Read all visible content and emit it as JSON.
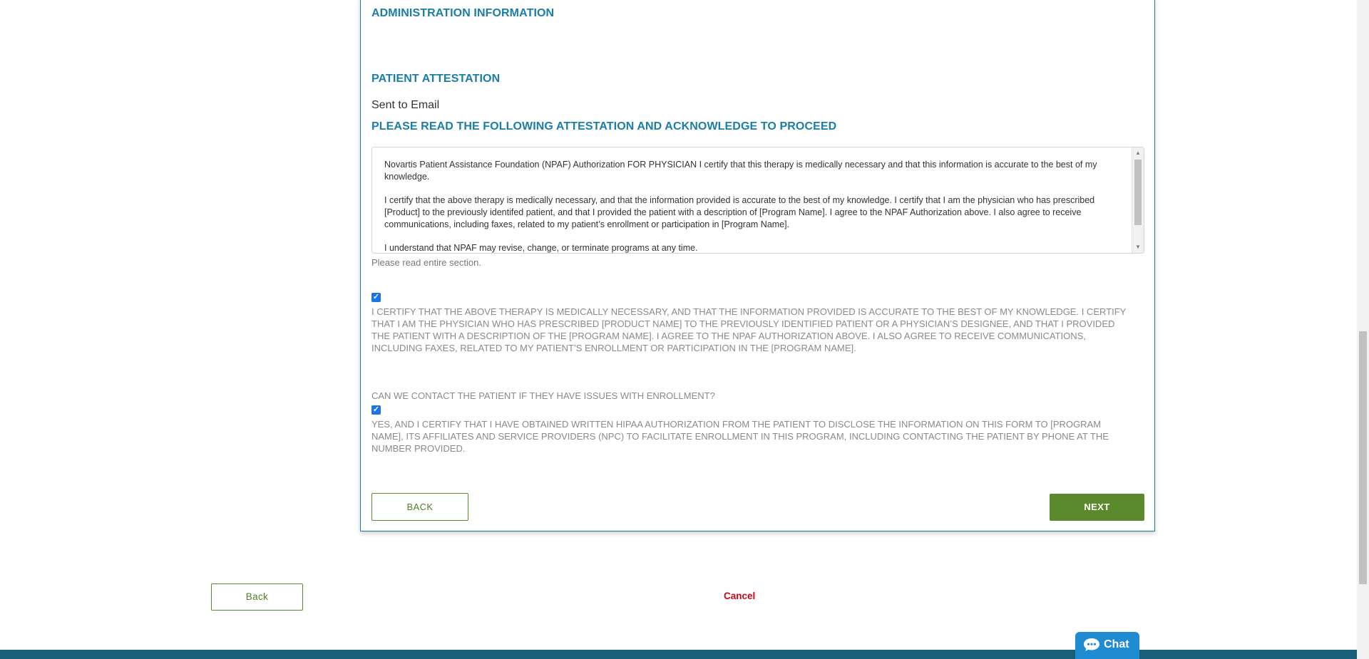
{
  "headings": {
    "admin": "ADMINISTRATION INFORMATION",
    "patient_attestation": "PATIENT ATTESTATION",
    "read_attestation": "PLEASE READ THE FOLLOWING ATTESTATION AND ACKNOWLEDGE TO PROCEED"
  },
  "sent_to": "Sent to Email",
  "attestation_text": {
    "p1": "Novartis Patient Assistance Foundation (NPAF) Authorization FOR PHYSICIAN I certify that this therapy is medically necessary and that this information is accurate to the best of my knowledge.",
    "p2": "I certify that the above therapy is medically necessary, and that the information provided is accurate to the best of my knowledge. I certify that I am the physician who has prescribed [Product] to the previously identifed patient, and that I provided the patient with a description of [Program Name]. I agree to the NPAF Authorization above. I also agree to receive communications, including faxes, related to my patient’s enrollment or participation in [Program Name].",
    "p3": "I understand that NPAF may revise, change, or terminate programs at any time."
  },
  "hint": "Please read entire section.",
  "certify_checkbox": {
    "checked": true,
    "label": "I CERTIFY THAT THE ABOVE THERAPY IS MEDICALLY NECESSARY, AND THAT THE INFORMATION PROVIDED IS ACCURATE TO THE BEST OF MY KNOWLEDGE. I CERTIFY THAT I AM THE PHYSICIAN WHO HAS PRESCRIBED [PRODUCT NAME] TO THE PREVIOUSLY IDENTIFIED PATIENT OR A PHYSICIAN’S DESIGNEE, AND THAT I PROVIDED THE PATIENT WITH A DESCRIPTION OF THE [PROGRAM NAME]. I AGREE TO THE NPAF AUTHORIZATION ABOVE. I ALSO AGREE TO RECEIVE COMMUNICATIONS, INCLUDING FAXES, RELATED TO MY PATIENT’S ENROLLMENT OR PARTICIPATION IN THE [PROGRAM NAME]."
  },
  "contact_question": "CAN WE CONTACT THE PATIENT IF THEY HAVE ISSUES WITH ENROLLMENT?",
  "contact_checkbox": {
    "checked": true,
    "label": "YES, AND I CERTIFY THAT I HAVE OBTAINED WRITTEN HIPAA AUTHORIZATION FROM THE PATIENT TO DISCLOSE THE INFORMATION ON THIS FORM TO [PROGRAM NAME], ITS AFFILIATES AND SERVICE PROVIDERS (NPC) TO FACILITATE ENROLLMENT IN THIS PROGRAM, INCLUDING CONTACTING THE PATIENT BY PHONE AT THE NUMBER PROVIDED."
  },
  "buttons": {
    "back": "BACK",
    "next": "NEXT",
    "page_back": "Back",
    "cancel": "Cancel",
    "chat": "Chat"
  },
  "colors": {
    "heading": "#1a7ea8",
    "primary_green": "#5a8a2c",
    "cancel_red": "#d0021b",
    "chat_blue": "#1f8bd1",
    "footer": "#1a5f7a"
  },
  "icons": [
    "chevron-up-icon",
    "chevron-down-icon",
    "checkmark-icon",
    "chat-bubble-icon"
  ]
}
